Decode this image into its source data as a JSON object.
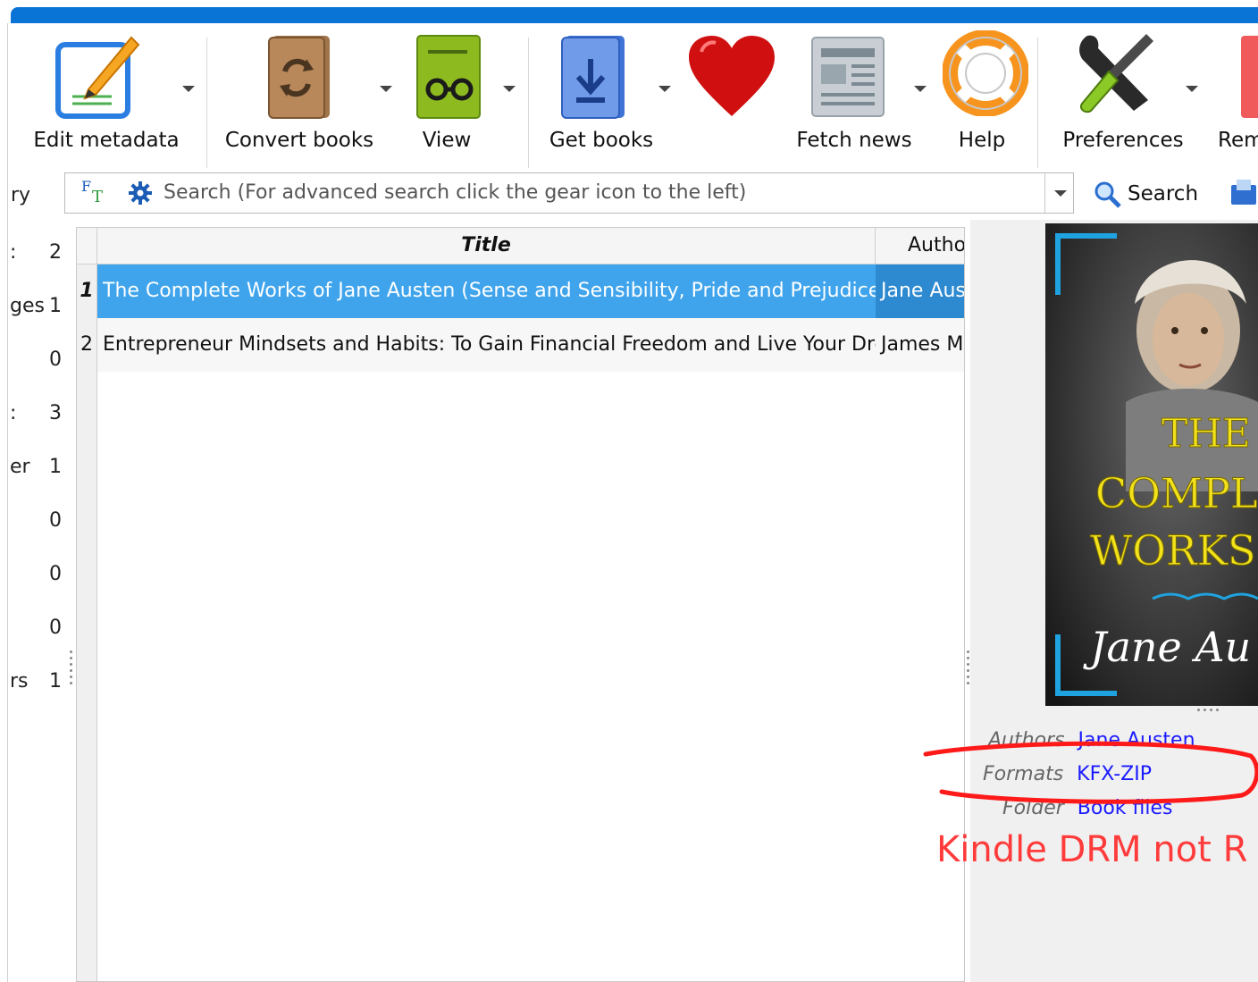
{
  "toolbar": {
    "items": [
      {
        "label": "Edit metadata",
        "icon": "edit-metadata-icon"
      },
      {
        "label": "Convert books",
        "icon": "convert-books-icon"
      },
      {
        "label": "View",
        "icon": "view-icon"
      },
      {
        "label": "Get books",
        "icon": "get-books-icon"
      },
      {
        "label": "",
        "icon": "heart-icon"
      },
      {
        "label": "Fetch news",
        "icon": "fetch-news-icon"
      },
      {
        "label": "Help",
        "icon": "help-lifebuoy-icon"
      },
      {
        "label": "Preferences",
        "icon": "preferences-tools-icon"
      },
      {
        "label": "Rem",
        "icon": "remove-books-icon"
      }
    ]
  },
  "search": {
    "left_label": "ry",
    "placeholder": "Search (For advanced search click the gear icon to the left)",
    "button_label": "Search"
  },
  "tag_browser": {
    "rows": [
      {
        "name": ":",
        "count": "2"
      },
      {
        "name": "ges",
        "count": "1"
      },
      {
        "name": "",
        "count": "0"
      },
      {
        "name": ":",
        "count": "3"
      },
      {
        "name": "er",
        "count": "1"
      },
      {
        "name": "",
        "count": "0"
      },
      {
        "name": "",
        "count": "0"
      },
      {
        "name": "",
        "count": "0"
      },
      {
        "name": "rs",
        "count": "1"
      }
    ]
  },
  "book_list": {
    "columns": [
      "Title",
      "Autho"
    ],
    "rows": [
      {
        "num": "1",
        "title": "The Complete Works of Jane Austen (Sense and Sensibility, Pride and Prejudice,...",
        "author": "Jane Aus"
      },
      {
        "num": "2",
        "title": "Entrepreneur Mindsets and Habits: To Gain Financial Freedom and Live Your Dre...",
        "author": "James M"
      }
    ]
  },
  "details": {
    "cover_text": {
      "line1": "THE",
      "line2": "COMPLE",
      "line3": "WORKS",
      "signature": "Jane Au"
    },
    "authors_key": "Authors",
    "authors_val": "Jane Austen",
    "formats_key": "Formats",
    "formats_val": "KFX-ZIP",
    "folder_key": "Folder",
    "folder_val": "Book files",
    "drm_note": "Kindle DRM not R"
  },
  "colors": {
    "accent": "#0a74d6",
    "selection": "#3fa4ec",
    "link": "#1a1aff",
    "annotation": "#ff2222"
  }
}
